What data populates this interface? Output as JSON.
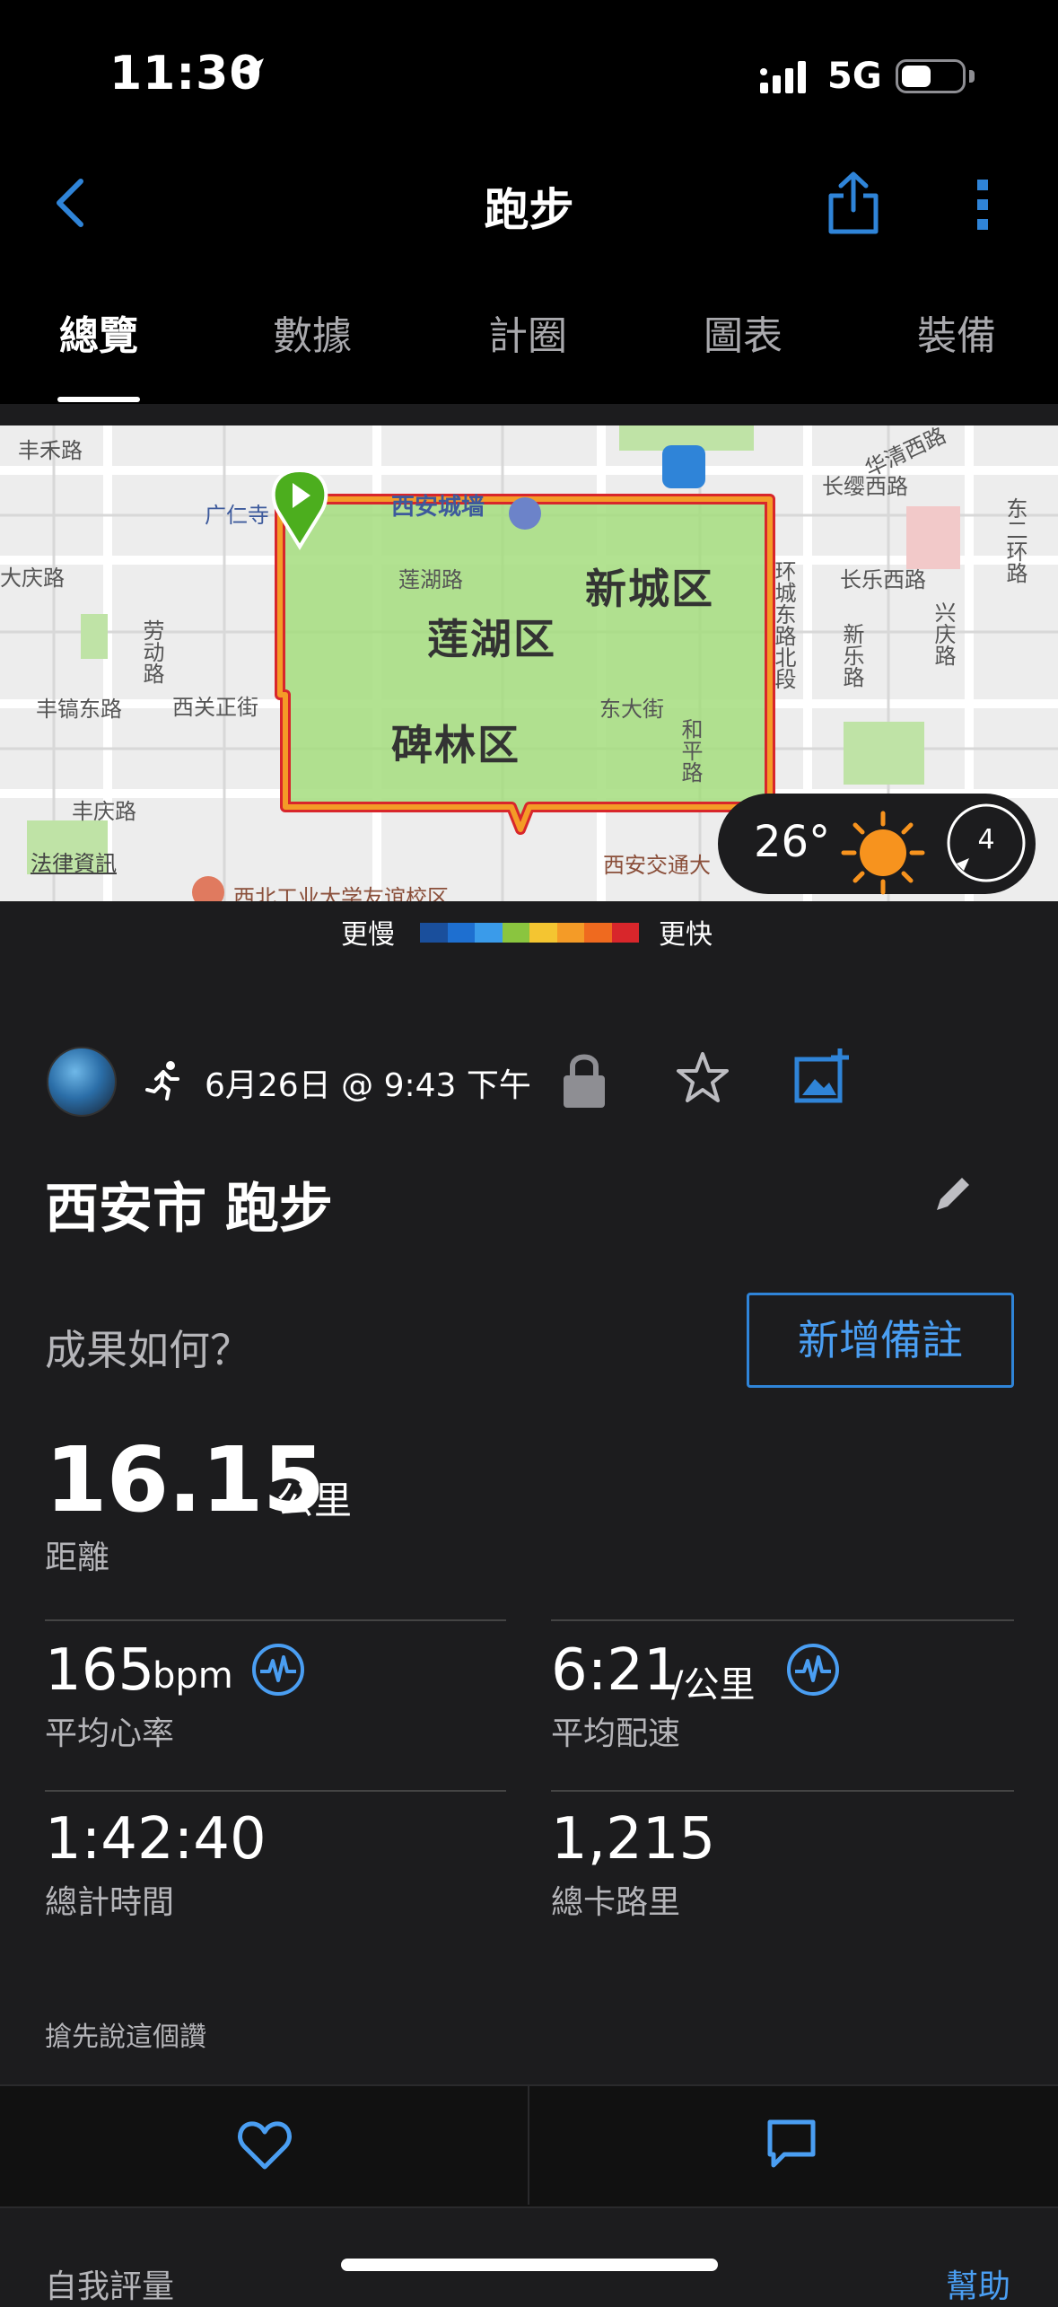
{
  "status": {
    "time": "11:30",
    "network": "5G"
  },
  "nav": {
    "title": "跑步"
  },
  "tabs": [
    {
      "label": "總覽",
      "active": true
    },
    {
      "label": "數據"
    },
    {
      "label": "計圈"
    },
    {
      "label": "圖表"
    },
    {
      "label": "裝備"
    }
  ],
  "map": {
    "labels": {
      "road_1": "丰禾路",
      "road_2": "西安城墙",
      "road_3": "广仁寺",
      "road_4": "长缨西路",
      "road_5": "华清西路",
      "road_6": "东二环路",
      "road_7": "大庆路",
      "road_8": "莲湖路",
      "road_9": "长乐西路",
      "road_10": "环城东路北段",
      "road_11": "劳动路",
      "road_12": "新乐路",
      "road_13": "兴庆路",
      "road_14": "丰镐东路",
      "road_15": "西关正街",
      "road_16": "东大街",
      "road_17": "和平路",
      "road_18": "丰庆路",
      "road_19": "西安交通大",
      "road_20": "西北工业大学友谊校区",
      "road_21": "法律資訊"
    },
    "districts": {
      "xincheng": "新城区",
      "lianhu": "莲湖区",
      "beilin": "碑林区"
    },
    "weather": {
      "temp": "26°",
      "wind": "4"
    }
  },
  "legend": {
    "slower": "更慢",
    "faster": "更快",
    "colors": [
      "#1a4f9c",
      "#1e6fd0",
      "#3a9bea",
      "#8ac53f",
      "#f4c531",
      "#f49b27",
      "#ef6a1f",
      "#d8262b"
    ]
  },
  "activity": {
    "date": "6月26日 @ 9:43 下午",
    "title": "西安市 跑步",
    "prompt": "成果如何？",
    "add_note": "新增備註"
  },
  "stats": {
    "distance_value": "16.15",
    "distance_unit": "公里",
    "distance_label": "距離",
    "hr_value": "165",
    "hr_unit": "bpm",
    "hr_label": "平均心率",
    "pace_value": "6:21",
    "pace_unit": "/公里",
    "pace_label": "平均配速",
    "time_value": "1:42:40",
    "time_label": "總計時間",
    "cal_value": "1,215",
    "cal_label": "總卡路里"
  },
  "social": {
    "first_like": "搶先說這個讚"
  },
  "footer": {
    "self_eval": "自我評量",
    "help": "幫助"
  }
}
